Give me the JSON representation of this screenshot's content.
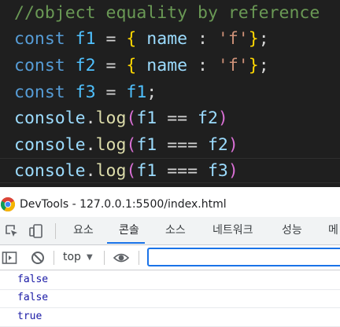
{
  "editor": {
    "lines": [
      {
        "tokens": [
          {
            "t": "//object equality by reference",
            "c": "comment"
          }
        ]
      },
      {
        "tokens": [
          {
            "t": "const ",
            "c": "keyword"
          },
          {
            "t": "f1",
            "c": "var"
          },
          {
            "t": " = ",
            "c": "op"
          },
          {
            "t": "{",
            "c": "brace"
          },
          {
            "t": " name ",
            "c": "prop"
          },
          {
            "t": ": ",
            "c": "op"
          },
          {
            "t": "'f'",
            "c": "str"
          },
          {
            "t": "}",
            "c": "brace"
          },
          {
            "t": ";",
            "c": "op"
          }
        ]
      },
      {
        "tokens": [
          {
            "t": "const ",
            "c": "keyword"
          },
          {
            "t": "f2",
            "c": "var"
          },
          {
            "t": " = ",
            "c": "op"
          },
          {
            "t": "{",
            "c": "brace"
          },
          {
            "t": " name ",
            "c": "prop"
          },
          {
            "t": ": ",
            "c": "op"
          },
          {
            "t": "'f'",
            "c": "str"
          },
          {
            "t": "}",
            "c": "brace"
          },
          {
            "t": ";",
            "c": "op"
          }
        ]
      },
      {
        "tokens": [
          {
            "t": "const ",
            "c": "keyword"
          },
          {
            "t": "f3",
            "c": "var"
          },
          {
            "t": " = ",
            "c": "op"
          },
          {
            "t": "f1",
            "c": "var"
          },
          {
            "t": ";",
            "c": "op"
          }
        ]
      },
      {
        "tokens": [
          {
            "t": "console",
            "c": "prop"
          },
          {
            "t": ".",
            "c": "op"
          },
          {
            "t": "log",
            "c": "fn"
          },
          {
            "t": "(",
            "c": "paren"
          },
          {
            "t": "f1",
            "c": "prop"
          },
          {
            "t": " == ",
            "c": "op"
          },
          {
            "t": "f2",
            "c": "prop"
          },
          {
            "t": ")",
            "c": "paren"
          }
        ]
      },
      {
        "tokens": [
          {
            "t": "console",
            "c": "prop"
          },
          {
            "t": ".",
            "c": "op"
          },
          {
            "t": "log",
            "c": "fn"
          },
          {
            "t": "(",
            "c": "paren"
          },
          {
            "t": "f1",
            "c": "prop"
          },
          {
            "t": " === ",
            "c": "op"
          },
          {
            "t": "f2",
            "c": "prop"
          },
          {
            "t": ")",
            "c": "paren"
          }
        ]
      },
      {
        "tokens": [
          {
            "t": "console",
            "c": "prop"
          },
          {
            "t": ".",
            "c": "op"
          },
          {
            "t": "log",
            "c": "fn"
          },
          {
            "t": "(",
            "c": "paren"
          },
          {
            "t": "f1",
            "c": "prop"
          },
          {
            "t": " === ",
            "c": "op"
          },
          {
            "t": "f3",
            "c": "prop"
          },
          {
            "t": ")",
            "c": "paren"
          }
        ]
      }
    ]
  },
  "devtools": {
    "window_title": "DevTools - 127.0.0.1:5500/index.html",
    "tabs": [
      {
        "label": "요소",
        "name": "tab-elements",
        "active": false
      },
      {
        "label": "콘솔",
        "name": "tab-console",
        "active": true
      },
      {
        "label": "소스",
        "name": "tab-sources",
        "active": false
      },
      {
        "label": "네트워크",
        "name": "tab-network",
        "active": false
      },
      {
        "label": "성능",
        "name": "tab-performance",
        "active": false
      },
      {
        "label": "메",
        "name": "tab-memory",
        "active": false
      }
    ],
    "toolbar": {
      "context_label": "top",
      "filter_value": ""
    },
    "icons": {
      "inspect": "inspect-element-icon",
      "device": "device-toolbar-icon",
      "sidebar": "sidebar-toggle-icon",
      "clear": "clear-console-icon",
      "eye": "live-expression-eye-icon",
      "dropdown": "dropdown-arrow-icon"
    },
    "output": [
      "false",
      "false",
      "true"
    ]
  },
  "colors": {
    "editor_bg": "#1f1f1f",
    "comment": "#6a9955",
    "keyword": "#569cd6",
    "accent": "#1a73e8",
    "console_value": "#1a1aa6"
  }
}
